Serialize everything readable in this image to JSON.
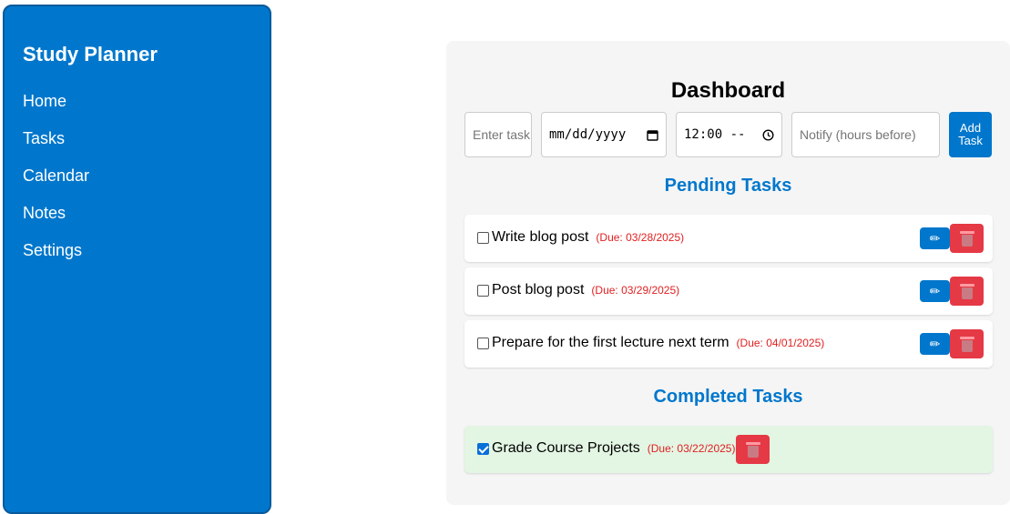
{
  "sidebar": {
    "title": "Study Planner",
    "items": [
      {
        "label": "Home"
      },
      {
        "label": "Tasks"
      },
      {
        "label": "Calendar"
      },
      {
        "label": "Notes"
      },
      {
        "label": "Settings"
      }
    ]
  },
  "dashboard": {
    "title": "Dashboard",
    "form": {
      "task_placeholder": "Enter task",
      "date_value": "mm/dd/yyyy",
      "time_value": "12:00 --",
      "notify_placeholder": "Notify (hours before)",
      "add_label": "Add Task"
    },
    "pending_title": "Pending Tasks",
    "completed_title": "Completed Tasks",
    "pending": [
      {
        "text": "Write blog post",
        "due": "(Due: 03/28/2025)"
      },
      {
        "text": "Post blog post",
        "due": "(Due: 03/29/2025)"
      },
      {
        "text": "Prepare for the first lecture next term",
        "due": "(Due: 04/01/2025)"
      }
    ],
    "completed": [
      {
        "text": "Grade Course Projects",
        "due": "(Due: 03/22/2025)"
      }
    ],
    "icons": {
      "edit": "✏",
      "delete": "trash-icon",
      "calendar": "calendar-icon",
      "clock": "clock-icon"
    },
    "colors": {
      "accent": "#0077cc",
      "danger": "#e53945",
      "due": "#e02020",
      "done_bg": "#e3f5e3"
    }
  }
}
